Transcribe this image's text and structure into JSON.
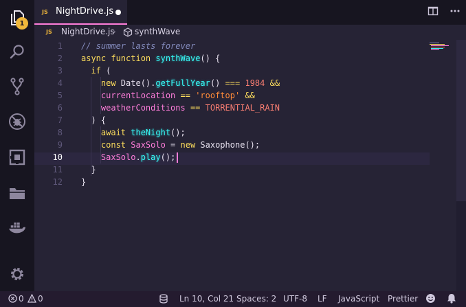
{
  "activity_bar": {
    "explorer_badge": "1",
    "items": [
      {
        "name": "explorer-icon"
      },
      {
        "name": "search-icon"
      },
      {
        "name": "source-control-icon"
      },
      {
        "name": "debug-icon"
      },
      {
        "name": "extensions-icon"
      },
      {
        "name": "folder-icon"
      },
      {
        "name": "docker-icon"
      },
      {
        "name": "settings-gear-icon"
      }
    ]
  },
  "tab": {
    "icon_label": "JS",
    "title": "NightDrive.js",
    "modified_icon": "dirty-dot-icon"
  },
  "tab_actions": [
    "split-editor-icon",
    "more-actions-icon"
  ],
  "breadcrumb": {
    "file_icon_label": "JS",
    "file": "NightDrive.js",
    "separator": "›",
    "symbol_icon": "cube-symbol-icon",
    "symbol": "synthWave"
  },
  "editor": {
    "active_line": 10,
    "lines": [
      {
        "n": "1",
        "tokens": [
          {
            "t": "// summer lasts forever",
            "c": "comment"
          }
        ]
      },
      {
        "n": "2",
        "tokens": [
          {
            "t": "async ",
            "c": "kw"
          },
          {
            "t": "function ",
            "c": "kw"
          },
          {
            "t": "synthWave",
            "c": "fn"
          },
          {
            "t": "() {",
            "c": "plain"
          }
        ]
      },
      {
        "n": "3",
        "tokens": [
          {
            "t": "  if ",
            "c": "kw"
          },
          {
            "t": "(",
            "c": "plain"
          }
        ]
      },
      {
        "n": "4",
        "tokens": [
          {
            "t": "    new ",
            "c": "kw"
          },
          {
            "t": "Date",
            "c": "plain"
          },
          {
            "t": "().",
            "c": "plain"
          },
          {
            "t": "getFullYear",
            "c": "fn"
          },
          {
            "t": "() ",
            "c": "plain"
          },
          {
            "t": "===",
            "c": "op"
          },
          {
            "t": " ",
            "c": "plain"
          },
          {
            "t": "1984",
            "c": "num"
          },
          {
            "t": " ",
            "c": "plain"
          },
          {
            "t": "&&",
            "c": "op"
          }
        ]
      },
      {
        "n": "5",
        "tokens": [
          {
            "t": "    currentLocation ",
            "c": "var"
          },
          {
            "t": "==",
            "c": "op"
          },
          {
            "t": " ",
            "c": "plain"
          },
          {
            "t": "'rooftop'",
            "c": "str"
          },
          {
            "t": " ",
            "c": "plain"
          },
          {
            "t": "&&",
            "c": "op"
          }
        ]
      },
      {
        "n": "6",
        "tokens": [
          {
            "t": "    weatherConditions ",
            "c": "var"
          },
          {
            "t": "==",
            "c": "op"
          },
          {
            "t": " ",
            "c": "plain"
          },
          {
            "t": "TORRENTIAL_RAIN",
            "c": "const"
          }
        ]
      },
      {
        "n": "7",
        "tokens": [
          {
            "t": "  ) {",
            "c": "plain"
          }
        ]
      },
      {
        "n": "8",
        "tokens": [
          {
            "t": "    await ",
            "c": "kw"
          },
          {
            "t": "theNight",
            "c": "fn"
          },
          {
            "t": "();",
            "c": "plain"
          }
        ]
      },
      {
        "n": "9",
        "tokens": [
          {
            "t": "    const ",
            "c": "kw"
          },
          {
            "t": "SaxSolo ",
            "c": "var"
          },
          {
            "t": "= ",
            "c": "plain"
          },
          {
            "t": "new ",
            "c": "kw"
          },
          {
            "t": "Saxophone",
            "c": "plain"
          },
          {
            "t": "();",
            "c": "plain"
          }
        ]
      },
      {
        "n": "10",
        "tokens": [
          {
            "t": "    SaxSolo",
            "c": "var"
          },
          {
            "t": ".",
            "c": "plain"
          },
          {
            "t": "play",
            "c": "fn"
          },
          {
            "t": "();",
            "c": "plain"
          }
        ]
      },
      {
        "n": "11",
        "tokens": [
          {
            "t": "  }",
            "c": "plain"
          }
        ]
      },
      {
        "n": "12",
        "tokens": [
          {
            "t": "}",
            "c": "plain"
          }
        ]
      }
    ]
  },
  "status_bar": {
    "errors": "0",
    "warnings": "0",
    "position": "Ln 10, Col 21",
    "spaces": "Spaces: 2",
    "encoding": "UTF-8",
    "eol": "LF",
    "language": "JavaScript",
    "formatter": "Prettier"
  },
  "colors": {
    "background": "#262335",
    "activity_bar": "#171520",
    "status_bar": "#241b2f",
    "accent_pink": "#ff7edb",
    "keyword_yellow": "#fede5d",
    "function_cyan": "#36f9f6",
    "badge_orange": "#f0b73b"
  }
}
